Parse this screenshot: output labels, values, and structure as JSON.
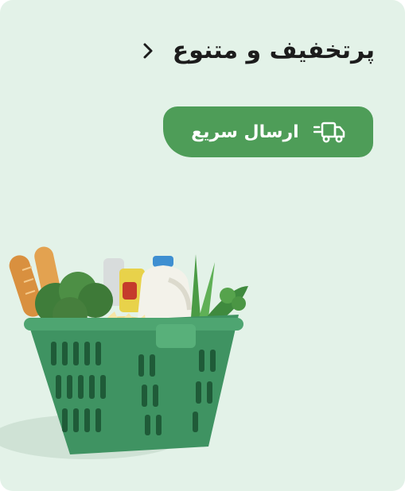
{
  "card": {
    "title": "پرتخفیف و متنوع",
    "badge_label": "ارسال سریع",
    "badge_icon": "delivery-truck-icon",
    "chevron_icon": "chevron-right-icon",
    "image": "grocery-basket-illustration"
  },
  "colors": {
    "background": "#e3f2e8",
    "badge": "#4e9d58",
    "basket": "#3f9362",
    "title_text": "#1c1c1c"
  }
}
